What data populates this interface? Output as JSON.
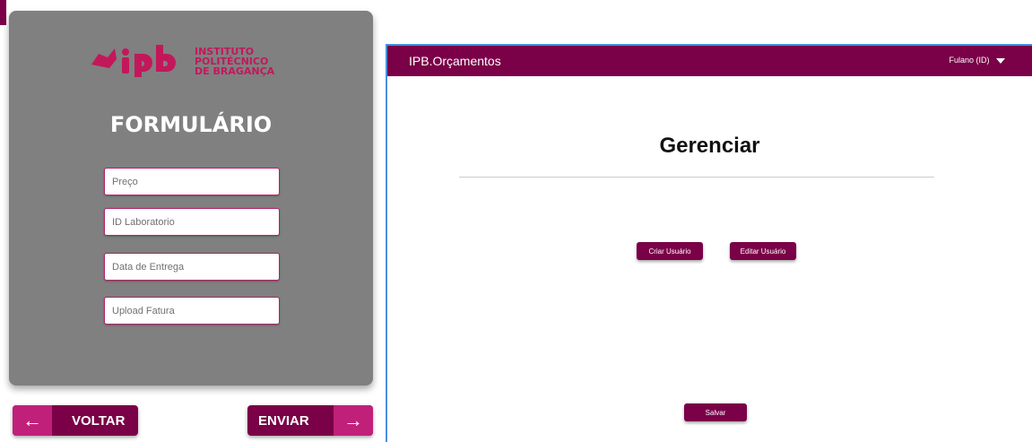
{
  "form": {
    "logo": {
      "brand": "ipb",
      "line1": "INSTITUTO POLITÉCNICO",
      "line2": "DE BRAGANÇA"
    },
    "title": "FORMULÁRIO",
    "fields": [
      {
        "placeholder": "Preço"
      },
      {
        "placeholder": "ID Laboratorio"
      },
      {
        "placeholder": "Data de Entrega"
      },
      {
        "placeholder": "Upload Fatura"
      }
    ],
    "back_label": "VOLTAR",
    "send_label": "ENVIAR",
    "back_icon": "arrow-left-icon",
    "send_icon": "arrow-right-icon"
  },
  "app": {
    "title": "IPB.Orçamentos",
    "user_menu": "Fulano (ID)",
    "page_title": "Gerenciar",
    "create_user": "Criar Usuário",
    "edit_user": "Editar Usuário",
    "save": "Salvar"
  },
  "colors": {
    "brand": "#7a0047",
    "accent": "#c0207a",
    "card": "#808080",
    "frame": "#4a90e2"
  }
}
